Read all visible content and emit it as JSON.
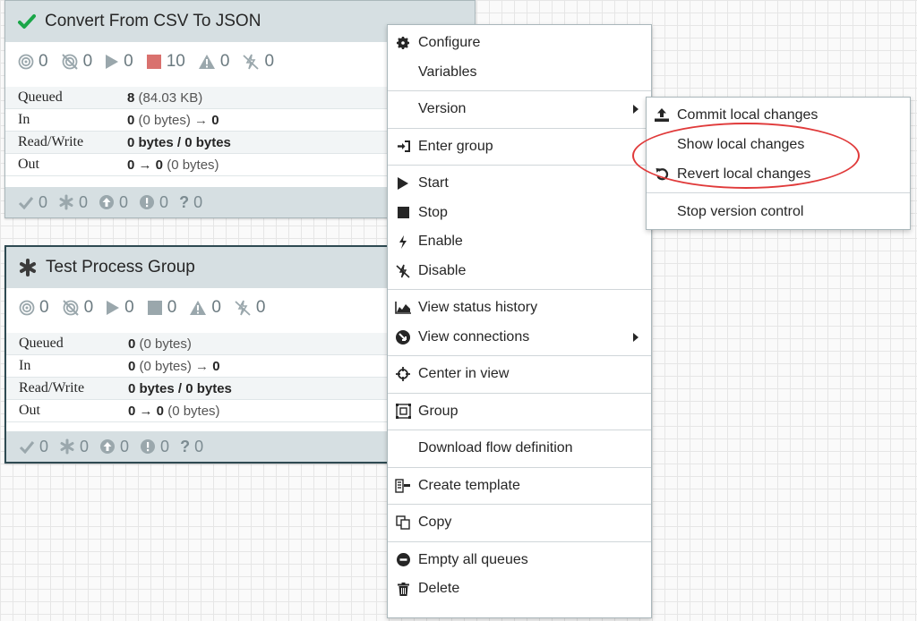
{
  "groups": [
    {
      "title": "Convert From CSV To JSON",
      "status_icon": "check-icon",
      "stats": {
        "transmitting": "0",
        "not_transmitting": "0",
        "running": "0",
        "stopped": "10",
        "invalid": "0",
        "disabled": "0"
      },
      "rows": [
        {
          "label": "Queued",
          "bold": "8",
          "rest": " (84.03 KB)"
        },
        {
          "label": "In",
          "bold": "0",
          "rest": " (0 bytes) → ",
          "bold2": "0"
        },
        {
          "label": "Read/Write",
          "bold": "0 bytes / 0 bytes",
          "rest": ""
        },
        {
          "label": "Out",
          "bold": "0 → 0",
          "rest": " (0 bytes)"
        }
      ],
      "footer": {
        "up_to_date": "0",
        "locally_modified": "0",
        "stale": "0",
        "stale_modified": "0",
        "sync_failure": "0"
      }
    },
    {
      "title": "Test Process Group",
      "status_icon": "asterisk-icon",
      "stats": {
        "transmitting": "0",
        "not_transmitting": "0",
        "running": "0",
        "stopped": "0",
        "invalid": "0",
        "disabled": "0"
      },
      "rows": [
        {
          "label": "Queued",
          "bold": "0",
          "rest": " (0 bytes)"
        },
        {
          "label": "In",
          "bold": "0",
          "rest": " (0 bytes) → ",
          "bold2": "0"
        },
        {
          "label": "Read/Write",
          "bold": "0 bytes / 0 bytes",
          "rest": ""
        },
        {
          "label": "Out",
          "bold": "0 → 0",
          "rest": " (0 bytes)"
        }
      ],
      "footer": {
        "up_to_date": "0",
        "locally_modified": "0",
        "stale": "0",
        "stale_modified": "0",
        "sync_failure": "0"
      }
    }
  ],
  "context_menu": {
    "configure": "Configure",
    "variables": "Variables",
    "version": "Version",
    "enter_group": "Enter group",
    "start": "Start",
    "stop": "Stop",
    "enable": "Enable",
    "disable": "Disable",
    "view_status_history": "View status history",
    "view_connections": "View connections",
    "center_in_view": "Center in view",
    "group": "Group",
    "download_flow_definition": "Download flow definition",
    "create_template": "Create template",
    "copy": "Copy",
    "empty_all_queues": "Empty all queues",
    "delete": "Delete"
  },
  "version_submenu": {
    "commit": "Commit local changes",
    "show": "Show local changes",
    "revert": "Revert local changes",
    "stop_vc": "Stop version control"
  },
  "colors": {
    "accent_check": "#1aa648",
    "stopped_red": "#d9716e",
    "highlight": "#e03a3a",
    "header_bg": "#d6dfe2"
  }
}
